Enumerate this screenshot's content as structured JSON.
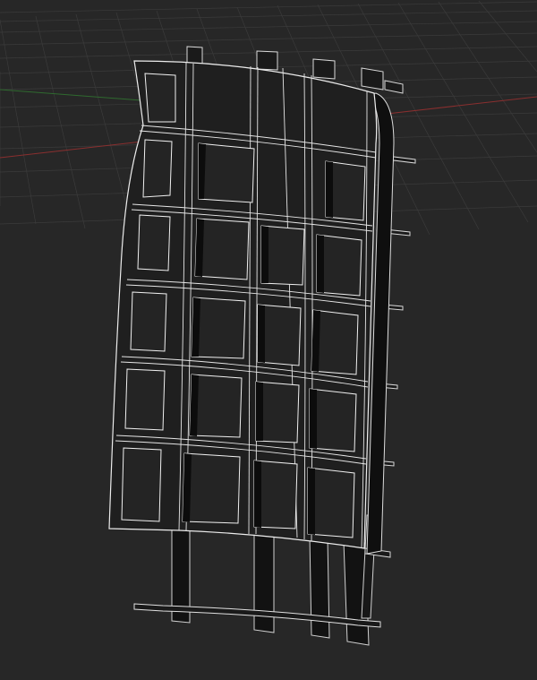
{
  "viewport": {
    "view": "perspective",
    "background_color": "#272727",
    "grid_color": "#3b3b3b",
    "x_axis_color": "#8a2f2f",
    "y_axis_color": "#2f6a2f"
  },
  "model": {
    "type": "curved-lattice-panel",
    "columns": 4,
    "rows": 6,
    "support_fins": 4,
    "side_ribs": 7,
    "wire_color": "#e8e8e8",
    "fill_color": "#161616",
    "edge_color": "#2a2a2a"
  }
}
